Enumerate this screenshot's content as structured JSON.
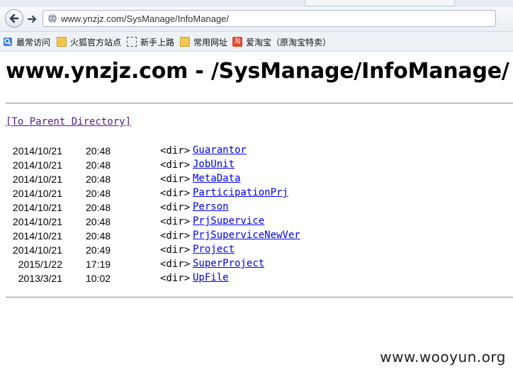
{
  "browser": {
    "url": "www.ynzjz.com/SysManage/InfoManage/",
    "bookmarks": [
      {
        "label": "最常访问",
        "icon": "bookmarks-icon"
      },
      {
        "label": "火狐官方站点",
        "icon": "folder-icon"
      },
      {
        "label": "新手上路",
        "icon": "dashed-page-icon"
      },
      {
        "label": "常用网址",
        "icon": "folder-icon"
      },
      {
        "label": "爱淘宝（原淘宝特卖）",
        "icon": "taobao-icon",
        "icon_text": "淘"
      }
    ]
  },
  "page": {
    "title": "www.ynzjz.com - /SysManage/InfoManage/",
    "parent_link": "[To Parent Directory]",
    "entries": [
      {
        "date": "2014/10/21",
        "time": "20:48",
        "type": "<dir>",
        "name": "Guarantor"
      },
      {
        "date": "2014/10/21",
        "time": "20:48",
        "type": "<dir>",
        "name": "JobUnit"
      },
      {
        "date": "2014/10/21",
        "time": "20:48",
        "type": "<dir>",
        "name": "MetaData"
      },
      {
        "date": "2014/10/21",
        "time": "20:48",
        "type": "<dir>",
        "name": "ParticipationPrj"
      },
      {
        "date": "2014/10/21",
        "time": "20:48",
        "type": "<dir>",
        "name": "Person"
      },
      {
        "date": "2014/10/21",
        "time": "20:48",
        "type": "<dir>",
        "name": "PrjSupervice"
      },
      {
        "date": "2014/10/21",
        "time": "20:48",
        "type": "<dir>",
        "name": "PrjSuperviceNewVer"
      },
      {
        "date": "2014/10/21",
        "time": "20:49",
        "type": "<dir>",
        "name": "Project"
      },
      {
        "date": "2015/1/22",
        "time": "17:19",
        "type": "<dir>",
        "name": "SuperProject"
      },
      {
        "date": "2013/3/21",
        "time": "10:02",
        "type": "<dir>",
        "name": "UpFile"
      }
    ]
  },
  "watermark": "www.wooyun.org",
  "colors": {
    "link": "#0000ee",
    "visited_link": "#551a8b"
  }
}
